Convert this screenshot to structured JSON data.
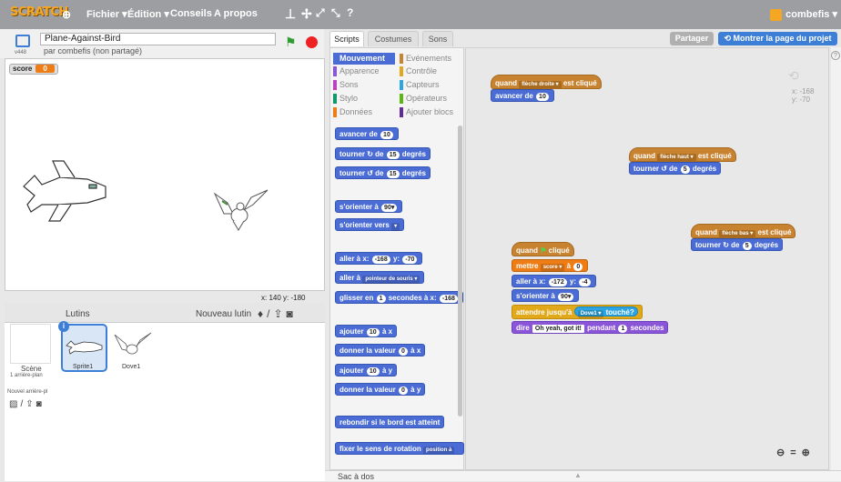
{
  "topbar": {
    "logo": "SCRATCH",
    "menus": [
      "Fichier ▾",
      "Édition ▾",
      "Conseils",
      "A propos"
    ],
    "user": "combefis ▾"
  },
  "project": {
    "title": "Plane-Against-Bird",
    "owner": "par combefis (non partagé)",
    "version": "v448"
  },
  "stage": {
    "variable_name": "score",
    "variable_value": "0",
    "coords": "x: 140   y: -180"
  },
  "sprites_pane": {
    "title": "Lutins",
    "new_sprite": "Nouveau lutin",
    "scene_label": "Scène",
    "scene_sub": "1 arrière-plan",
    "new_backdrop": "Nouvel arrière-pl",
    "sprites": [
      "Sprite1",
      "Dove1"
    ]
  },
  "tabs": [
    "Scripts",
    "Costumes",
    "Sons"
  ],
  "header_buttons": {
    "share": "Partager",
    "see_page": "Montrer la page du projet"
  },
  "categories": [
    {
      "label": "Mouvement",
      "color": "#4a6cd4"
    },
    {
      "label": "Apparence",
      "color": "#8a55d7"
    },
    {
      "label": "Sons",
      "color": "#bb42c3"
    },
    {
      "label": "Stylo",
      "color": "#0e9a6c"
    },
    {
      "label": "Données",
      "color": "#ee7d16"
    },
    {
      "label": "Evénements",
      "color": "#c88330"
    },
    {
      "label": "Contrôle",
      "color": "#e1a91a"
    },
    {
      "label": "Capteurs",
      "color": "#2ca5e2"
    },
    {
      "label": "Opérateurs",
      "color": "#5cb712"
    },
    {
      "label": "Ajouter blocs",
      "color": "#632d99"
    }
  ],
  "palette_blocks": {
    "move": [
      "avancer de",
      "10"
    ],
    "turn_right": [
      "tourner ↻ de",
      "15",
      "degrés"
    ],
    "turn_left": [
      "tourner ↺ de",
      "15",
      "degrés"
    ],
    "point_dir": [
      "s'orienter à",
      "90▾"
    ],
    "point_towards": [
      "s'orienter vers",
      "▾"
    ],
    "goto_xy": [
      "aller à x:",
      "-168",
      "y:",
      "-70"
    ],
    "goto": [
      "aller à",
      "pointeur de souris ▾"
    ],
    "glide": [
      "glisser en",
      "1",
      "secondes à x:",
      "-168"
    ],
    "change_x": [
      "ajouter",
      "10",
      "à x"
    ],
    "set_x": [
      "donner la valeur",
      "0",
      "à x"
    ],
    "change_y": [
      "ajouter",
      "10",
      "à y"
    ],
    "set_y": [
      "donner la valeur",
      "0",
      "à y"
    ],
    "bounce": "rebondir si le bord est atteint",
    "rotation": [
      "fixer le sens de rotation",
      "position à"
    ]
  },
  "scripts": {
    "s1_hat": [
      "quand",
      "flèche droite ▾",
      "est cliqué"
    ],
    "s1_move": [
      "avancer de",
      "10"
    ],
    "s2_hat": [
      "quand",
      "flèche haut ▾",
      "est cliqué"
    ],
    "s2_turn": [
      "tourner ↺ de",
      "5",
      "degrés"
    ],
    "s3_hat": [
      "quand",
      "flèche bas ▾",
      "est cliqué"
    ],
    "s3_turn": [
      "tourner ↻ de",
      "5",
      "degrés"
    ],
    "s4_hat": [
      "quand",
      "⚑",
      "cliqué"
    ],
    "s4_set": [
      "mettre",
      "score ▾",
      "à",
      "0"
    ],
    "s4_goto": [
      "aller à x:",
      "-172",
      "y:",
      "-4"
    ],
    "s4_point": [
      "s'orienter à",
      "90▾"
    ],
    "s4_wait": [
      "attendre jusqu'à",
      "Dove1 ▾",
      "touché?"
    ],
    "s4_say": [
      "dire",
      "Oh yeah, got it!",
      "pendant",
      "1",
      "secondes"
    ]
  },
  "sprite_info": {
    "x": "x: -168",
    "y": "y: -70"
  },
  "backpack": "Sac à dos"
}
